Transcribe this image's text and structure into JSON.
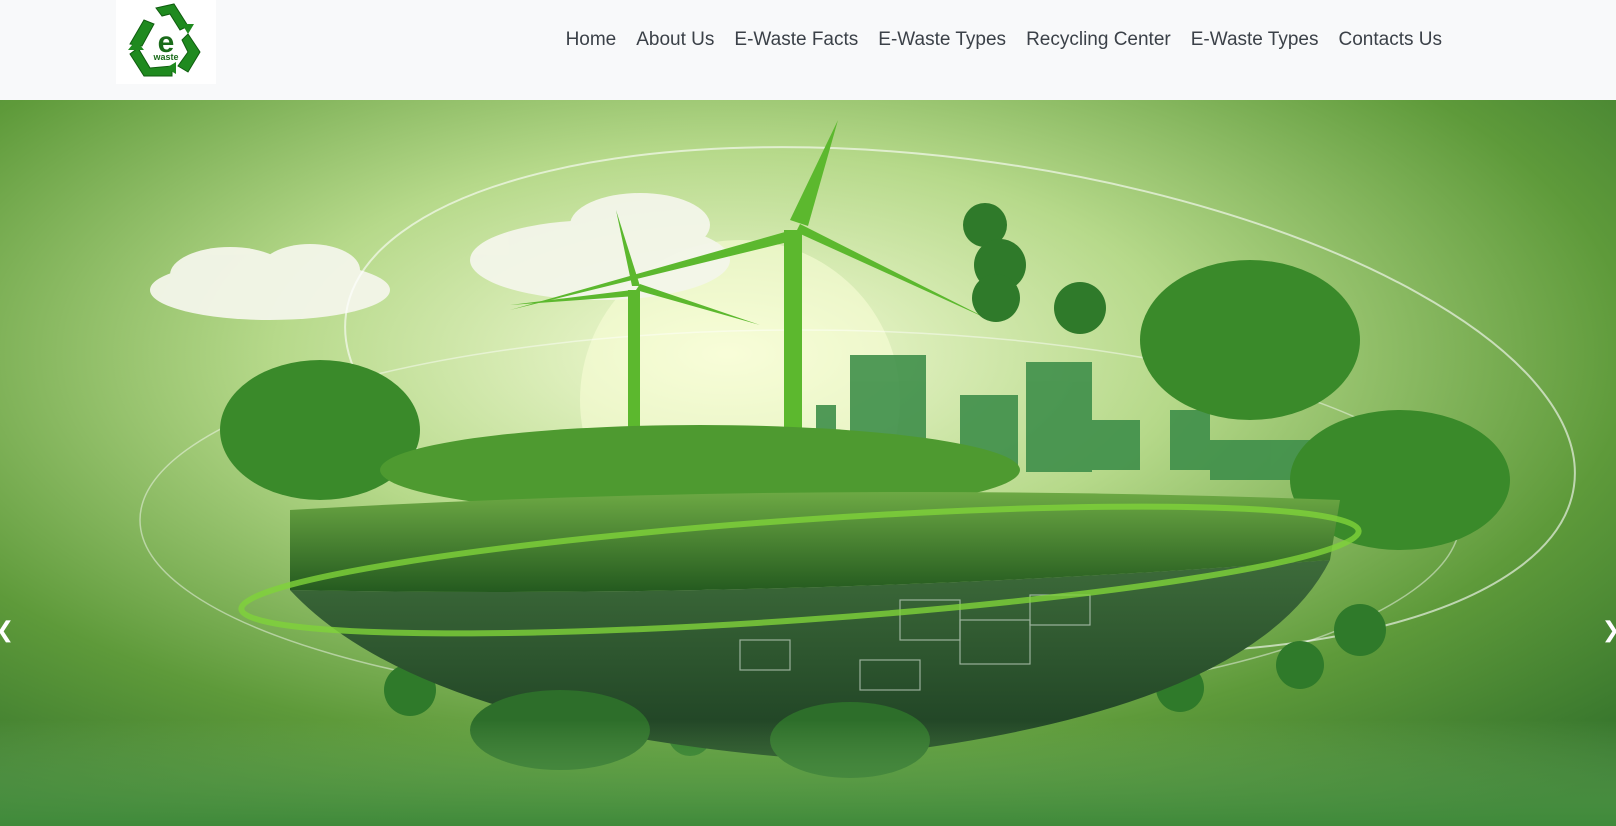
{
  "logo": {
    "text_main": "e",
    "text_sub": "waste",
    "icon": "recycle-logo-icon"
  },
  "nav": {
    "items": [
      {
        "label": "Home"
      },
      {
        "label": "About Us"
      },
      {
        "label": "E-Waste Facts"
      },
      {
        "label": "E-Waste Types"
      },
      {
        "label": "Recycling Center"
      },
      {
        "label": "E-Waste Types"
      },
      {
        "label": "Contacts Us"
      }
    ]
  },
  "carousel": {
    "prev_icon": "chevron-left-icon",
    "next_icon": "chevron-right-icon",
    "slide_image": "green-earth-wind-turbine-illustration"
  },
  "colors": {
    "brand_green": "#1f8a1f",
    "nav_text": "#3b4148",
    "navbar_bg": "#f8f9fa"
  }
}
